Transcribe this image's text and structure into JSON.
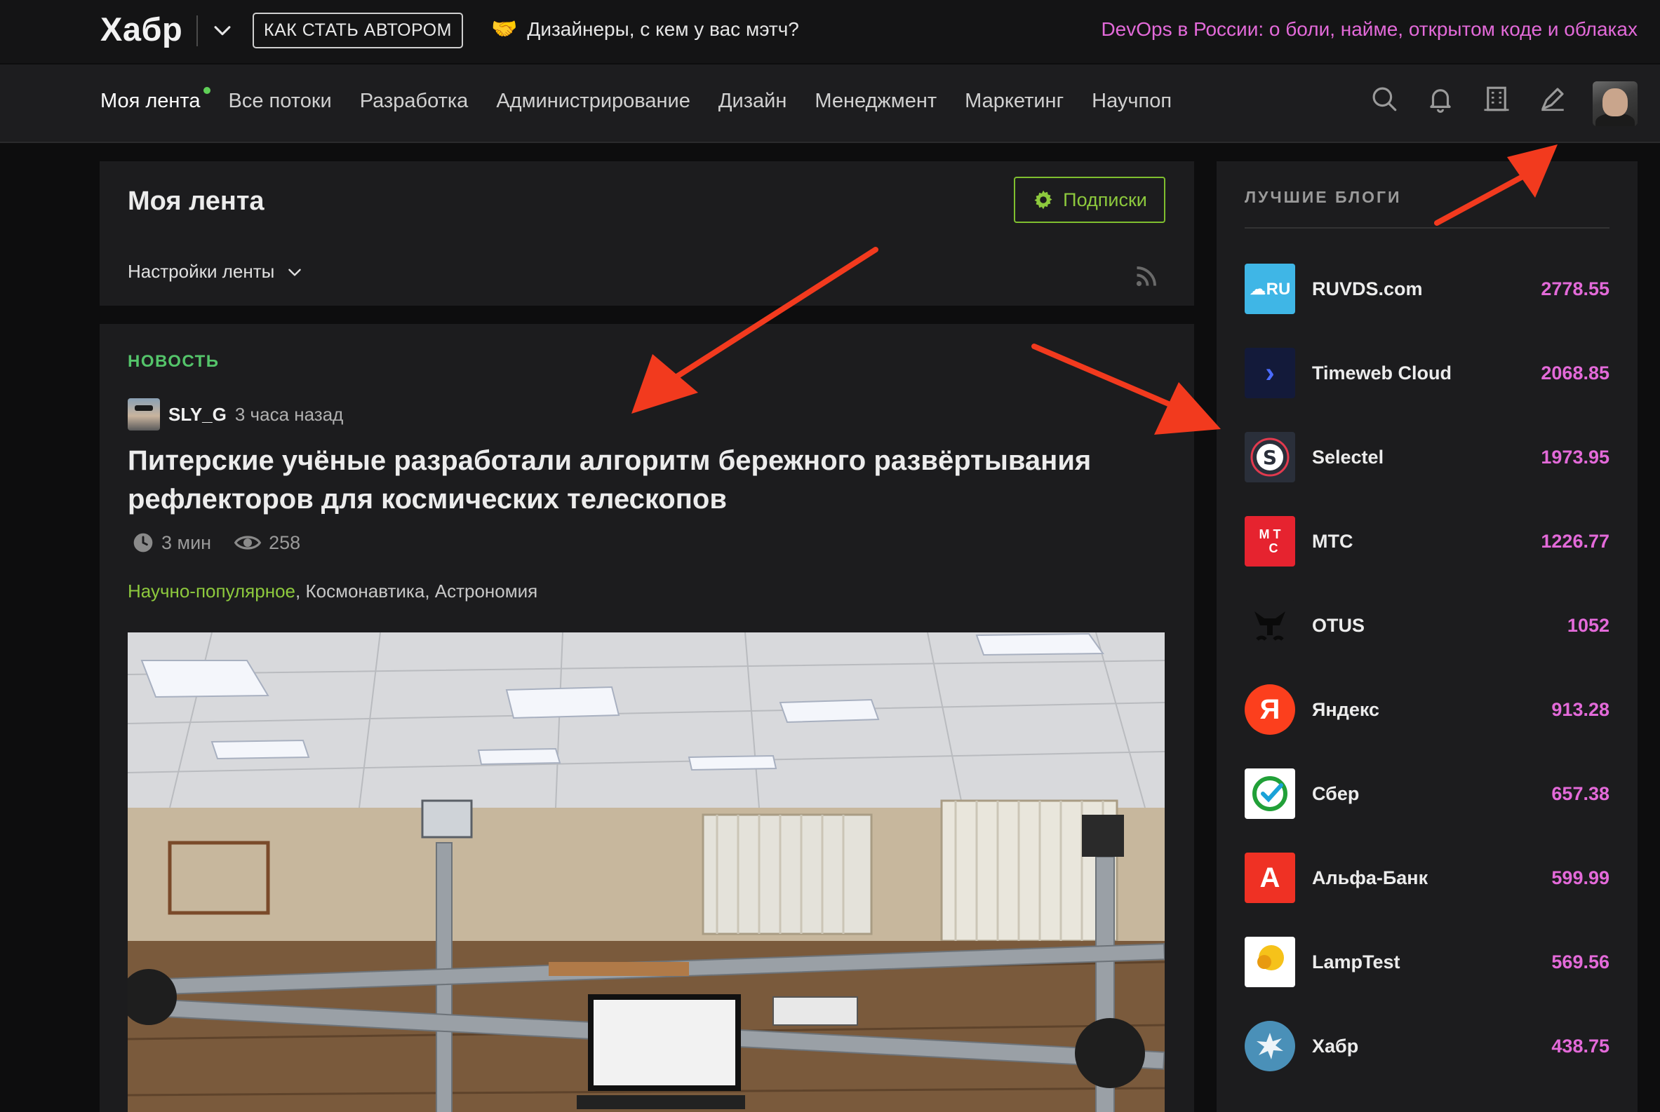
{
  "topbar": {
    "logo": "Хабр",
    "author_button": "КАК СТАТЬ АВТОРОМ",
    "promo_left": "Дизайнеры, с кем у вас мэтч?",
    "promo_left_icon": "handshake-icon",
    "promo_right": "DevOps в России: о боли, найме, открытом коде и облаках"
  },
  "nav": {
    "items": [
      "Моя лента",
      "Все потоки",
      "Разработка",
      "Администрирование",
      "Дизайн",
      "Менеджмент",
      "Маркетинг",
      "Научпоп"
    ],
    "icons": [
      "search-icon",
      "bell-icon",
      "building-icon",
      "pen-icon"
    ]
  },
  "feed": {
    "title": "Моя лента",
    "subscriptions_button": "Подписки",
    "settings_label": "Настройки ленты"
  },
  "article": {
    "label": "НОВОСТЬ",
    "author": "SLY_G",
    "time": "3 часа назад",
    "title": "Питерские учёные разработали алгоритм бережного развёртывания рефлекторов для космических телескопов",
    "read_time": "3 мин",
    "views": "258",
    "hubs": [
      "Научно-популярное",
      "Космонавтика",
      "Астрономия"
    ]
  },
  "sidebar": {
    "title": "ЛУЧШИЕ БЛОГИ",
    "blogs": [
      {
        "name": "RUVDS.com",
        "score": "2778.55",
        "color": "#3fb6e6"
      },
      {
        "name": "Timeweb Cloud",
        "score": "2068.85",
        "color": "#131a3a"
      },
      {
        "name": "Selectel",
        "score": "1973.95",
        "color": "#2a2f3a"
      },
      {
        "name": "МТС",
        "score": "1226.77",
        "color": "#e6232f"
      },
      {
        "name": "OTUS",
        "score": "1052",
        "color": "#1c1c1e"
      },
      {
        "name": "Яндекс",
        "score": "913.28",
        "color": "#fc3f1d"
      },
      {
        "name": "Сбер",
        "score": "657.38",
        "color": "#ffffff"
      },
      {
        "name": "Альфа-Банк",
        "score": "599.99",
        "color": "#ef3124"
      },
      {
        "name": "LampTest",
        "score": "569.56",
        "color": "#ffffff"
      },
      {
        "name": "Хабр",
        "score": "438.75",
        "color": "#4a90b8"
      }
    ]
  },
  "colors": {
    "accent_pink": "#e36ad9",
    "accent_green": "#8dc93d",
    "arrow_red": "#f23a1e"
  }
}
